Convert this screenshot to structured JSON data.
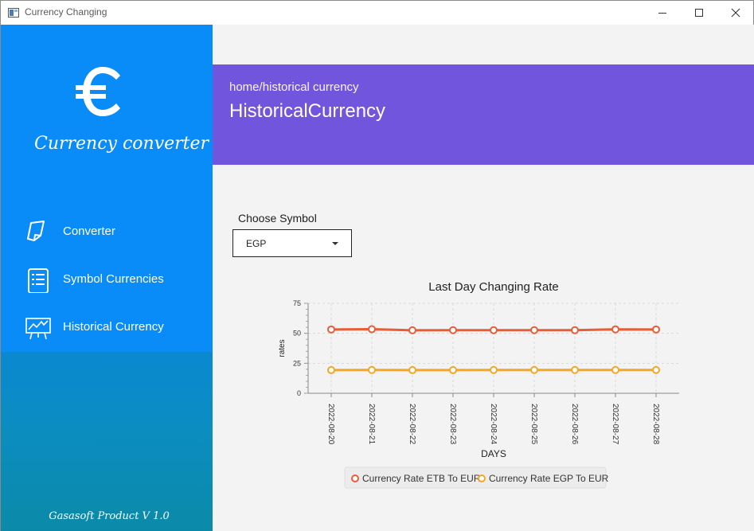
{
  "window": {
    "title": "Currency Changing"
  },
  "sidebar": {
    "brand": "Currency converter",
    "nav": [
      {
        "label": "Converter",
        "icon": "converter-icon"
      },
      {
        "label": "Symbol Currencies",
        "icon": "document-list-icon"
      },
      {
        "label": "Historical Currency",
        "icon": "chart-board-icon"
      }
    ],
    "footer": "Gasasoft Product V 1.0"
  },
  "header": {
    "breadcrumb": "home/historical currency",
    "title": "HistoricalCurrency"
  },
  "form": {
    "symbol_label": "Choose Symbol",
    "symbol_value": "EGP"
  },
  "colors": {
    "sidebar_blue": "#0a8cf8",
    "header_purple": "#7155dd",
    "series_etb": "#e85d36",
    "series_egp": "#f5a623"
  },
  "chart_data": {
    "type": "line",
    "title": "Last Day Changing Rate",
    "xlabel": "DAYS",
    "ylabel": "rates",
    "ylim": [
      0,
      75
    ],
    "yticks": [
      "0",
      "25",
      "50",
      "75"
    ],
    "categories": [
      "2022-08-20",
      "2022-08-21",
      "2022-08-22",
      "2022-08-23",
      "2022-08-24",
      "2022-08-25",
      "2022-08-26",
      "2022-08-27",
      "2022-08-28"
    ],
    "series": [
      {
        "name": "Currency Rate ETB To EUR",
        "values": [
          53.2,
          53.4,
          52.5,
          52.6,
          52.6,
          52.6,
          52.6,
          53.3,
          53.2
        ]
      },
      {
        "name": "Currency Rate EGP To EUR",
        "values": [
          19.3,
          19.4,
          19.3,
          19.3,
          19.4,
          19.4,
          19.4,
          19.4,
          19.4
        ]
      }
    ],
    "grid": true,
    "legend": "bottom"
  }
}
